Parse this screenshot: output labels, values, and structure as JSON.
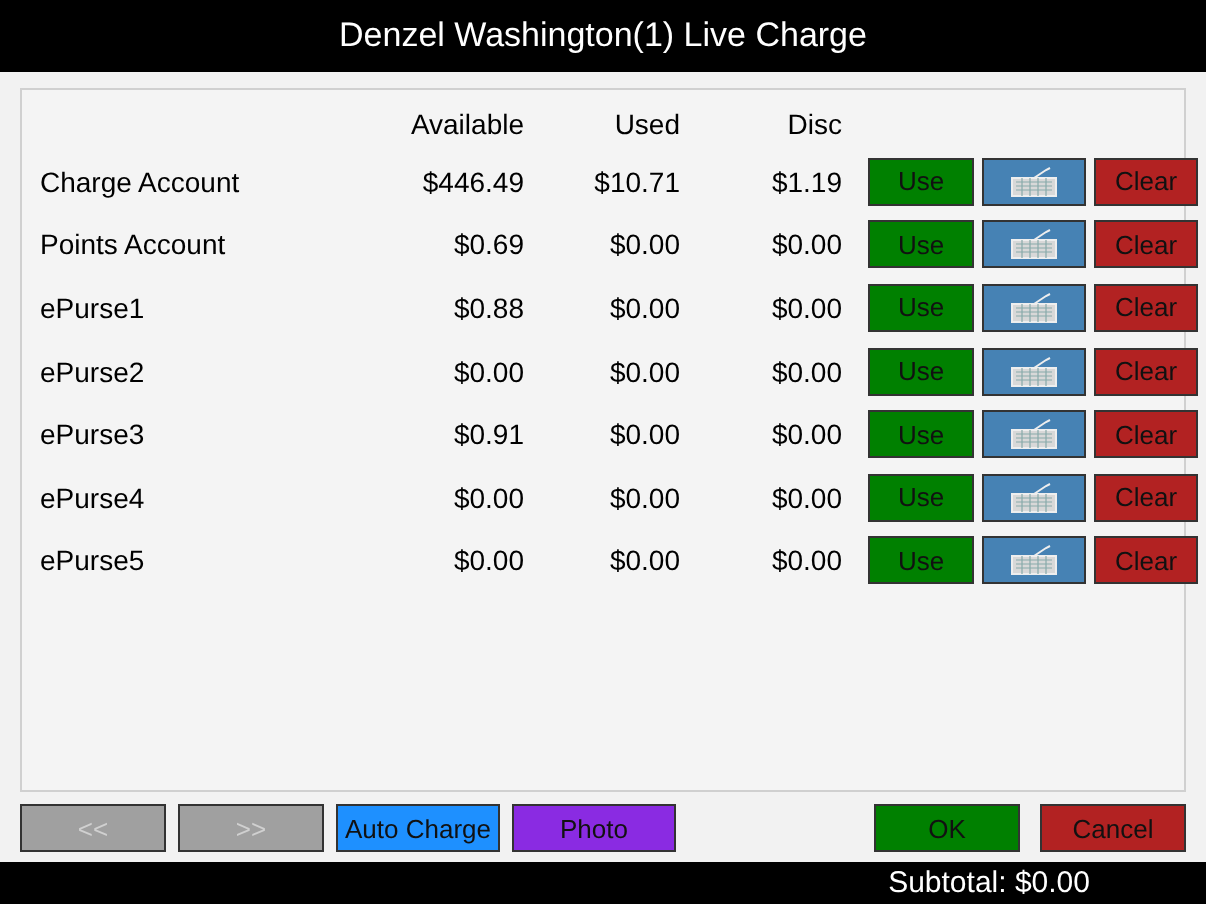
{
  "window": {
    "title": "Denzel Washington(1) Live Charge"
  },
  "table": {
    "columns": [
      "Available",
      "Used",
      "Disc"
    ],
    "rows": [
      {
        "name": "Charge Account",
        "available": "$446.49",
        "used": "$10.71",
        "disc": "$1.19",
        "use": "Use",
        "clear": "Clear"
      },
      {
        "name": "Points Account",
        "available": "$0.69",
        "used": "$0.00",
        "disc": "$0.00",
        "use": "Use",
        "clear": "Clear"
      },
      {
        "name": "ePurse1",
        "available": "$0.88",
        "used": "$0.00",
        "disc": "$0.00",
        "use": "Use",
        "clear": "Clear"
      },
      {
        "name": "ePurse2",
        "available": "$0.00",
        "used": "$0.00",
        "disc": "$0.00",
        "use": "Use",
        "clear": "Clear"
      },
      {
        "name": "ePurse3",
        "available": "$0.91",
        "used": "$0.00",
        "disc": "$0.00",
        "use": "Use",
        "clear": "Clear"
      },
      {
        "name": "ePurse4",
        "available": "$0.00",
        "used": "$0.00",
        "disc": "$0.00",
        "use": "Use",
        "clear": "Clear"
      },
      {
        "name": "ePurse5",
        "available": "$0.00",
        "used": "$0.00",
        "disc": "$0.00",
        "use": "Use",
        "clear": "Clear"
      }
    ]
  },
  "footer_buttons": [
    {
      "label": "<<",
      "kind": "nav",
      "disabled": true
    },
    {
      "label": ">>",
      "kind": "nav",
      "disabled": true
    },
    {
      "label": "Auto Charge",
      "kind": "auto",
      "disabled": false
    },
    {
      "label": "Photo",
      "kind": "photo",
      "disabled": false
    },
    {
      "label": "OK",
      "kind": "ok",
      "disabled": false
    },
    {
      "label": "Cancel",
      "kind": "cancel",
      "disabled": false
    }
  ],
  "status_bar": {
    "subtotal": "Subtotal: $0.00"
  }
}
